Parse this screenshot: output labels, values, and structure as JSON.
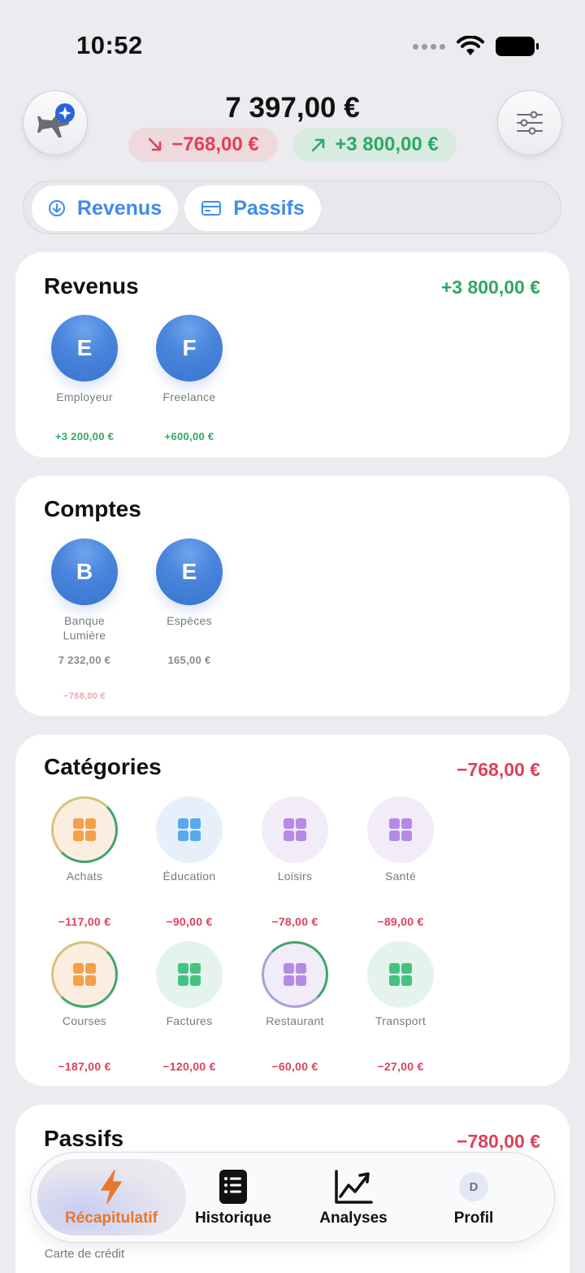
{
  "status_bar": {
    "time": "10:52"
  },
  "header": {
    "balance": "7 397,00 €",
    "expense_pill": "−768,00 €",
    "income_pill": "+3 800,00 €"
  },
  "filters": [
    {
      "label": "Revenus"
    },
    {
      "label": "Passifs"
    }
  ],
  "revenus": {
    "title": "Revenus",
    "total": "+3 800,00 €",
    "items": [
      {
        "initial": "E",
        "label": "Employeur",
        "amount": "+3 200,00 €"
      },
      {
        "initial": "F",
        "label": "Freelance",
        "amount": "+600,00 €"
      }
    ]
  },
  "comptes": {
    "title": "Comptes",
    "items": [
      {
        "initial": "B",
        "label": "Banque Lumière",
        "amount": "7 232,00 €",
        "sub_amount": "−768,00 €"
      },
      {
        "initial": "E",
        "label": "Espèces",
        "amount": "165,00 €"
      }
    ]
  },
  "categories": {
    "title": "Catégories",
    "total": "−768,00 €",
    "items": [
      {
        "label": "Achats",
        "amount": "−117,00 €",
        "color": "#f2a04a"
      },
      {
        "label": "Éducation",
        "amount": "−90,00 €",
        "color": "#5aa8ee"
      },
      {
        "label": "Loisirs",
        "amount": "−78,00 €",
        "color": "#b58ae6"
      },
      {
        "label": "Santé",
        "amount": "−89,00 €",
        "color": "#b58ae6"
      },
      {
        "label": "Courses",
        "amount": "−187,00 €",
        "color": "#f2a04a"
      },
      {
        "label": "Factures",
        "amount": "−120,00 €",
        "color": "#45c282"
      },
      {
        "label": "Restaurant",
        "amount": "−60,00 €",
        "color": "#b58ae6"
      },
      {
        "label": "Transport",
        "amount": "−27,00 €",
        "color": "#45c282"
      }
    ]
  },
  "passifs": {
    "title": "Passifs",
    "total": "−780,00 €",
    "peek_item_label": "Carte de crédit"
  },
  "tabbar": {
    "items": [
      {
        "label": "Récapitulatif",
        "icon": "bolt-icon"
      },
      {
        "label": "Historique",
        "icon": "list-icon"
      },
      {
        "label": "Analyses",
        "icon": "chart-icon"
      },
      {
        "label": "Profil",
        "icon": "avatar",
        "initial": "D"
      }
    ]
  },
  "colors": {
    "accent": "#3d8bef",
    "income": "#2fa865",
    "expense": "#e0405a",
    "active_tab": "#e8772e"
  }
}
